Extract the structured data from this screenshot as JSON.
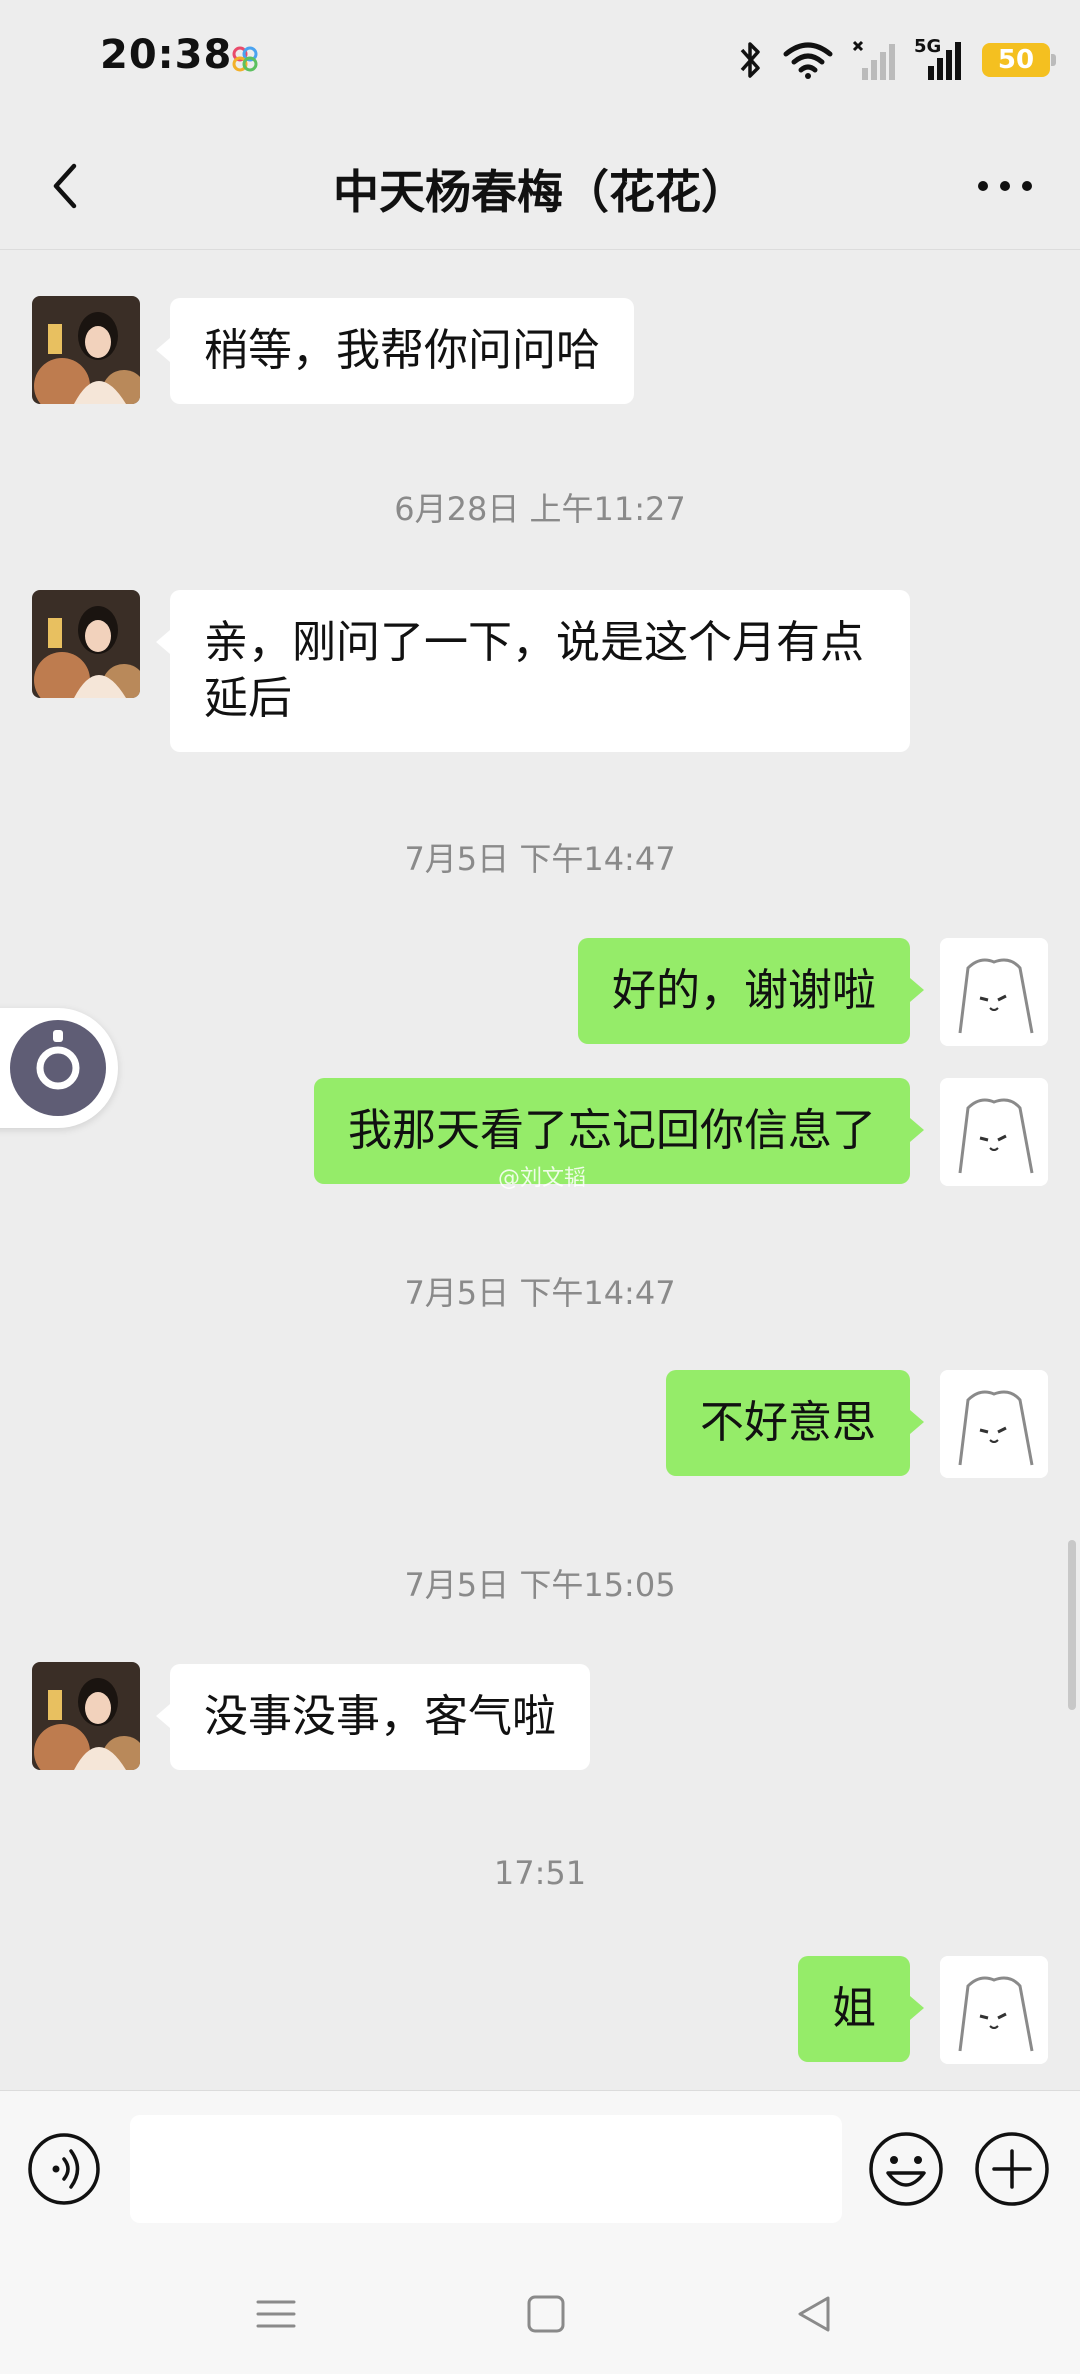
{
  "status_bar": {
    "time": "20:38",
    "network": "5G",
    "battery": "50"
  },
  "header": {
    "title": "中天杨春梅（花花）",
    "back_icon": "chevron-left-icon",
    "more_icon": "ellipsis-icon"
  },
  "messages": [
    {
      "type": "in",
      "text": "稍等，我帮你问问哈"
    },
    {
      "type": "time",
      "text": "6月28日 上午11:27"
    },
    {
      "type": "in",
      "text": "亲，刚问了一下，说是这个月有点延后"
    },
    {
      "type": "time",
      "text": "7月5日 下午14:47"
    },
    {
      "type": "out",
      "text": "好的，谢谢啦"
    },
    {
      "type": "out",
      "text": "我那天看了忘记回你信息了"
    },
    {
      "type": "time",
      "text": "7月5日 下午14:47"
    },
    {
      "type": "out",
      "text": "不好意思"
    },
    {
      "type": "time",
      "text": "7月5日 下午15:05"
    },
    {
      "type": "in",
      "text": "没事没事，客气啦"
    },
    {
      "type": "time",
      "text": "17:51"
    },
    {
      "type": "out",
      "text": "姐"
    }
  ],
  "watermark": "@刘文韬",
  "input_bar": {
    "value": "",
    "voice_icon": "voice-icon",
    "emoji_icon": "emoji-icon",
    "plus_icon": "plus-icon"
  },
  "nav_bar": {
    "menu_icon": "menu-icon",
    "home_icon": "home-square-icon",
    "back_icon": "back-triangle-icon"
  },
  "colors": {
    "background": "#ededed",
    "outgoing_bubble": "#95ec69",
    "incoming_bubble": "#ffffff",
    "timestamp": "#8a8a8a"
  }
}
